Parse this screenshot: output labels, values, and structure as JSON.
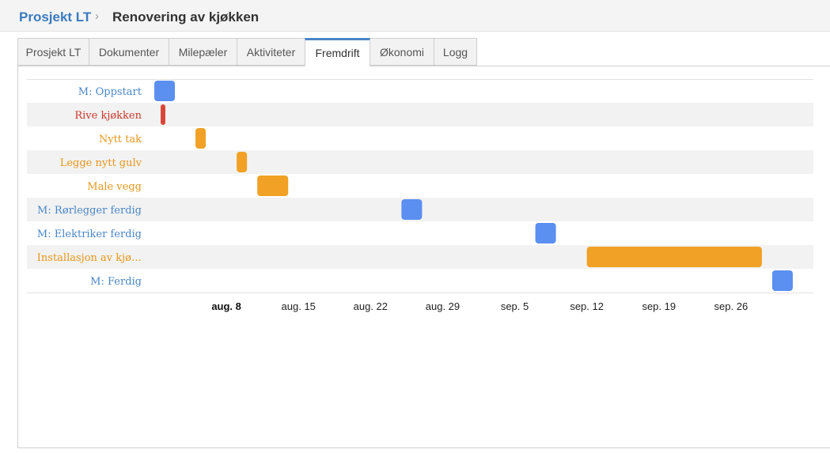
{
  "header": {
    "project": "Prosjekt LT",
    "separator": "›",
    "title": "Renovering av kjøkken"
  },
  "tabs": [
    {
      "label": "Prosjekt LT",
      "active": false
    },
    {
      "label": "Dokumenter",
      "active": false
    },
    {
      "label": "Milepæler",
      "active": false
    },
    {
      "label": "Aktiviteter",
      "active": false
    },
    {
      "label": "Fremdrift",
      "active": true
    },
    {
      "label": "Økonomi",
      "active": false
    },
    {
      "label": "Logg",
      "active": false
    }
  ],
  "colors": {
    "milestone": "#5b8ff0",
    "activity": "#f0a126",
    "critical": "#d9463a",
    "milestone_text": "#4a86c5",
    "activity_text": "#e8961a",
    "critical_text": "#c9382c"
  },
  "chart_data": {
    "type": "gantt",
    "x_axis_start": "2022-08-01",
    "x_axis_end": "2022-10-04",
    "ticks": [
      {
        "label": "aug. 8",
        "date": "2022-08-08",
        "bold": true
      },
      {
        "label": "aug. 15",
        "date": "2022-08-15",
        "bold": false
      },
      {
        "label": "aug. 22",
        "date": "2022-08-22",
        "bold": false
      },
      {
        "label": "aug. 29",
        "date": "2022-08-29",
        "bold": false
      },
      {
        "label": "sep. 5",
        "date": "2022-09-05",
        "bold": false
      },
      {
        "label": "sep. 12",
        "date": "2022-09-12",
        "bold": false
      },
      {
        "label": "sep. 19",
        "date": "2022-09-19",
        "bold": false
      },
      {
        "label": "sep. 26",
        "date": "2022-09-26",
        "bold": false
      }
    ],
    "rows": [
      {
        "label": "M: Oppstart",
        "kind": "milestone",
        "start": "2022-08-01",
        "end": "2022-08-03"
      },
      {
        "label": "Rive kjøkken",
        "kind": "critical",
        "start": "2022-08-01",
        "end": "2022-08-02"
      },
      {
        "label": "Nytt tak",
        "kind": "activity",
        "start": "2022-08-05",
        "end": "2022-08-06"
      },
      {
        "label": "Legge nytt gulv",
        "kind": "activity",
        "start": "2022-08-09",
        "end": "2022-08-10"
      },
      {
        "label": "Male vegg",
        "kind": "activity",
        "start": "2022-08-11",
        "end": "2022-08-14"
      },
      {
        "label": "M: Rørlegger ferdig",
        "kind": "milestone",
        "start": "2022-08-25",
        "end": "2022-08-27"
      },
      {
        "label": "M: Elektriker ferdig",
        "kind": "milestone",
        "start": "2022-09-07",
        "end": "2022-09-09"
      },
      {
        "label": "Installasjon av kjø…",
        "kind": "activity",
        "start": "2022-09-12",
        "end": "2022-09-29"
      },
      {
        "label": "M: Ferdig",
        "kind": "milestone",
        "start": "2022-09-30",
        "end": "2022-10-02"
      }
    ]
  }
}
